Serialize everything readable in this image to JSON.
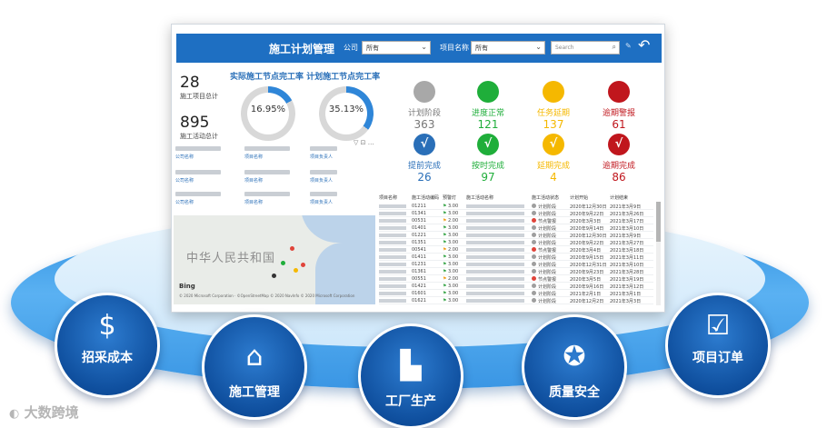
{
  "dashboard": {
    "title": "施工计划管理",
    "filters": {
      "company_label": "公司",
      "company_value": "所有",
      "project_label": "项目名称",
      "project_value": "所有",
      "search_placeholder": "Search"
    },
    "kpis": [
      {
        "value": "28",
        "label": "施工项目总计"
      },
      {
        "value": "895",
        "label": "施工活动总计"
      }
    ],
    "rates": {
      "title": "实际施工节点完工率 计划施工节点完工率",
      "actual": "16.95%",
      "planned": "35.13%",
      "actual_fraction": 0.1695,
      "planned_fraction": 0.3513
    },
    "blur_captions": [
      "公司名称",
      "项目名称",
      "项目负责人"
    ],
    "map": {
      "region_label": "中华人民共和国",
      "provider": "Bing",
      "copyright": "© 2020 Microsoft Corporation · ©OpenStreetMap © 2020 NavInfo © 2020 Microsoft Corporation"
    },
    "statuses": [
      {
        "label": "计划阶段",
        "count": "363",
        "color": "#a8a8a8",
        "check": false
      },
      {
        "label": "进度正常",
        "count": "121",
        "color": "#1fae3a",
        "check": false
      },
      {
        "label": "任务延期",
        "count": "137",
        "color": "#f5b800",
        "check": false
      },
      {
        "label": "逾期警报",
        "count": "61",
        "color": "#c0161d",
        "check": false
      },
      {
        "label": "提前完成",
        "count": "26",
        "color": "#2a6fb8",
        "check": true
      },
      {
        "label": "按时完成",
        "count": "97",
        "color": "#1fae3a",
        "check": true
      },
      {
        "label": "延期完成",
        "count": "4",
        "color": "#f5b800",
        "check": true
      },
      {
        "label": "逾期完成",
        "count": "86",
        "color": "#c0161d",
        "check": true
      }
    ],
    "table": {
      "headers": [
        "项目名称",
        "施工活动编码",
        "预警灯",
        "施工活动名称",
        "施工活动状态",
        "计划开始",
        "计划结束"
      ],
      "rows": [
        {
          "code": "01211",
          "flag": "#3aa64a",
          "num": "3.00",
          "state": "计划阶段",
          "state_color": "#9e9e9e",
          "start": "2020年12月30日",
          "end": "2021年3月9日"
        },
        {
          "code": "01341",
          "flag": "#3aa64a",
          "num": "3.00",
          "state": "计划阶段",
          "state_color": "#9e9e9e",
          "start": "2020年9月22日",
          "end": "2021年3月26日"
        },
        {
          "code": "00531",
          "flag": "#f0a020",
          "num": "2.00",
          "state": "节点警报",
          "state_color": "#e0443a",
          "start": "2020年3月3日",
          "end": "2021年3月17日"
        },
        {
          "code": "01401",
          "flag": "#3aa64a",
          "num": "3.00",
          "state": "计划阶段",
          "state_color": "#9e9e9e",
          "start": "2020年9月14日",
          "end": "2021年3月10日"
        },
        {
          "code": "01221",
          "flag": "#3aa64a",
          "num": "3.00",
          "state": "计划阶段",
          "state_color": "#9e9e9e",
          "start": "2020年12月30日",
          "end": "2021年3月9日"
        },
        {
          "code": "01351",
          "flag": "#3aa64a",
          "num": "3.00",
          "state": "计划阶段",
          "state_color": "#9e9e9e",
          "start": "2020年9月22日",
          "end": "2021年3月27日"
        },
        {
          "code": "00541",
          "flag": "#f0a020",
          "num": "2.00",
          "state": "节点警报",
          "state_color": "#e0443a",
          "start": "2020年3月4日",
          "end": "2021年3月18日"
        },
        {
          "code": "01411",
          "flag": "#3aa64a",
          "num": "3.00",
          "state": "计划阶段",
          "state_color": "#9e9e9e",
          "start": "2020年9月15日",
          "end": "2021年3月11日"
        },
        {
          "code": "01231",
          "flag": "#3aa64a",
          "num": "3.00",
          "state": "计划阶段",
          "state_color": "#9e9e9e",
          "start": "2020年12月31日",
          "end": "2021年3月10日"
        },
        {
          "code": "01361",
          "flag": "#3aa64a",
          "num": "3.00",
          "state": "计划阶段",
          "state_color": "#9e9e9e",
          "start": "2020年9月23日",
          "end": "2021年3月28日"
        },
        {
          "code": "00551",
          "flag": "#f0a020",
          "num": "2.00",
          "state": "节点警报",
          "state_color": "#e0443a",
          "start": "2020年3月5日",
          "end": "2021年3月19日"
        },
        {
          "code": "01421",
          "flag": "#3aa64a",
          "num": "3.00",
          "state": "计划阶段",
          "state_color": "#9e9e9e",
          "start": "2020年9月16日",
          "end": "2021年3月12日"
        },
        {
          "code": "01601",
          "flag": "#3aa64a",
          "num": "3.00",
          "state": "计划阶段",
          "state_color": "#9e9e9e",
          "start": "2021年2月1日",
          "end": "2021年3月1日"
        },
        {
          "code": "01621",
          "flag": "#3aa64a",
          "num": "3.00",
          "state": "计划阶段",
          "state_color": "#9e9e9e",
          "start": "2020年12月2日",
          "end": "2021年3月3日"
        }
      ]
    }
  },
  "modules": [
    {
      "label": "招采成本",
      "icon": "coins-icon",
      "glyph": "$"
    },
    {
      "label": "施工管理",
      "icon": "crane-icon",
      "glyph": "⌂"
    },
    {
      "label": "工厂生产",
      "icon": "factory-icon",
      "glyph": "▙"
    },
    {
      "label": "质量安全",
      "icon": "medal-icon",
      "glyph": "✪"
    },
    {
      "label": "项目订单",
      "icon": "checklist-icon",
      "glyph": "☑"
    }
  ],
  "brand": {
    "name": "大数跨境",
    "mark": "logo-icon"
  },
  "colors": {
    "header": "#1e6fc2",
    "ring": "#3a96e4",
    "module": "#0f4f9e",
    "accent_blue": "#2a6fb8"
  }
}
